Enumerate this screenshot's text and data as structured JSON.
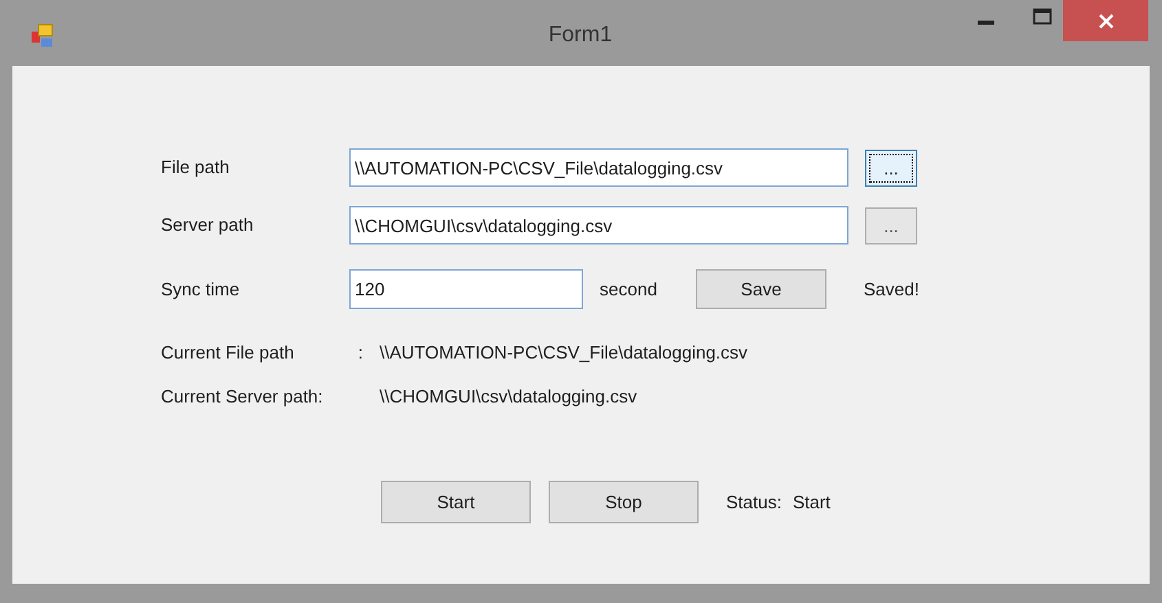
{
  "window": {
    "title": "Form1"
  },
  "fields": [
    {
      "label": "File path",
      "value": "\\\\AUTOMATION-PC\\CSV_File\\datalogging.csv",
      "browse": "...",
      "focused": true
    },
    {
      "label": "Server path",
      "value": "\\\\CHOMGUI\\csv\\datalogging.csv",
      "browse": "...",
      "focused": false
    }
  ],
  "sync": {
    "label": "Sync time",
    "value": "120",
    "unit": "second",
    "button": "Save",
    "message": "Saved!"
  },
  "current": [
    {
      "label": "Current File path",
      "separator": ":",
      "value": "\\\\AUTOMATION-PC\\CSV_File\\datalogging.csv"
    },
    {
      "label": "Current Server path:",
      "value": "\\\\CHOMGUI\\csv\\datalogging.csv"
    }
  ],
  "buttons": [
    "Start",
    "Stop"
  ],
  "status": {
    "label": "Status:",
    "value": "Start"
  }
}
